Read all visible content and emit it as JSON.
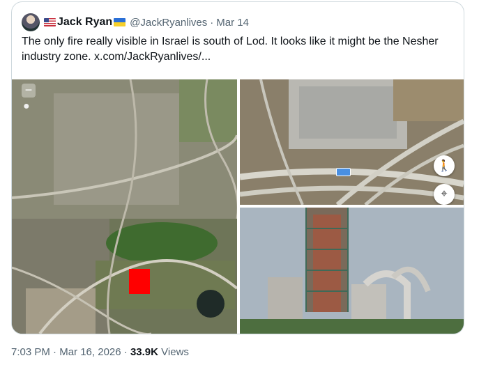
{
  "post": {
    "author_name": "Jack Ryan",
    "handle": "@JackRyanlives",
    "separator": "·",
    "date": "Mar 14",
    "text": "The only fire really visible in Israel is south of Lod. It looks like it might be the Nesher industry zone.  x.com/JackRyanlives/...",
    "flag_left": "us-flag-icon",
    "flag_right": "ukraine-flag-icon"
  },
  "footer": {
    "time": "7:03 PM",
    "dot1": "·",
    "date": "Mar 16, 2026",
    "dot2": "·",
    "views_count": "33.9K",
    "views_label": "Views"
  },
  "media": {
    "images": [
      "satellite-map-lod",
      "aerial-highway-interchange",
      "industrial-plant-photo"
    ],
    "highlight_color": "#ff0000"
  },
  "map_controls": {
    "zoom_out": "−"
  }
}
